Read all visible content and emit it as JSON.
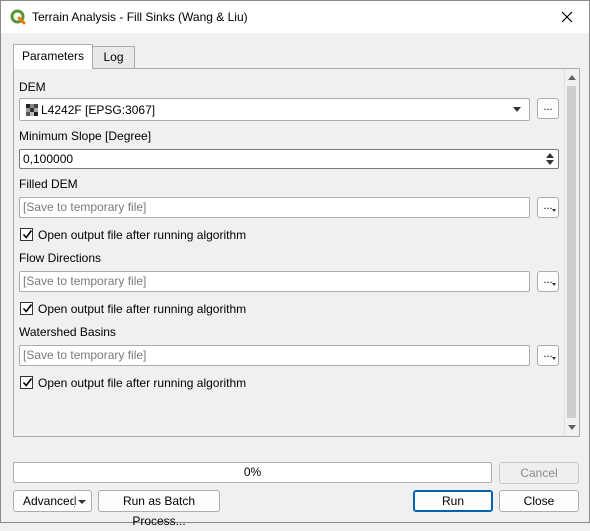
{
  "window": {
    "title": "Terrain Analysis - Fill Sinks (Wang & Liu)",
    "icon": "qgis-logo-icon",
    "close_icon": "close-icon"
  },
  "tabs": [
    {
      "label": "Parameters",
      "active": true
    },
    {
      "label": "Log",
      "active": false
    }
  ],
  "params": {
    "dem": {
      "label": "DEM",
      "value": "L4242F [EPSG:3067]",
      "browse_label": "..."
    },
    "min_slope": {
      "label": "Minimum Slope [Degree]",
      "value": "0,100000"
    },
    "filled_dem": {
      "label": "Filled DEM",
      "placeholder": "[Save to temporary file]",
      "browse_label": "...",
      "open_label": "Open output file after running algorithm",
      "open_checked": true
    },
    "flow_directions": {
      "label": "Flow Directions",
      "placeholder": "[Save to temporary file]",
      "browse_label": "...",
      "open_label": "Open output file after running algorithm",
      "open_checked": true
    },
    "watershed_basins": {
      "label": "Watershed Basins",
      "placeholder": "[Save to temporary file]",
      "browse_label": "...",
      "open_label": "Open output file after running algorithm",
      "open_checked": true
    }
  },
  "footer": {
    "progress_text": "0%",
    "progress_value": 0,
    "cancel_label": "Cancel",
    "advanced_label": "Advanced",
    "batch_label": "Run as Batch Process...",
    "run_label": "Run",
    "close_label": "Close"
  },
  "colors": {
    "accent": "#0063b1",
    "window_bg": "#f0f0f0"
  }
}
